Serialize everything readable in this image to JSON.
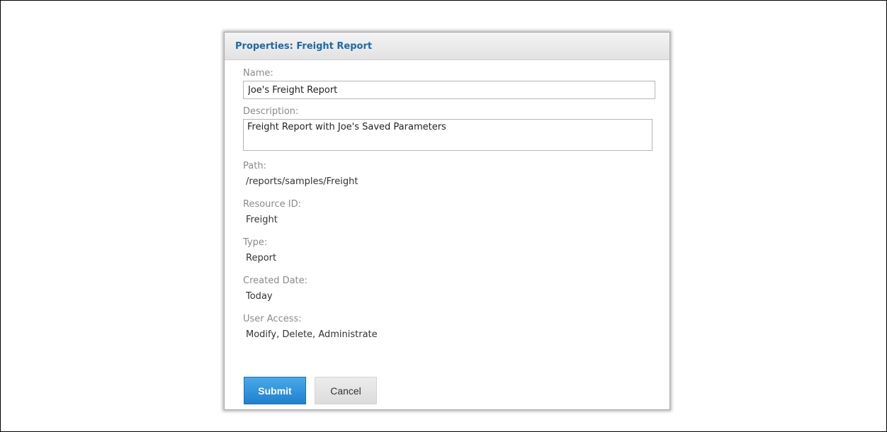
{
  "dialog": {
    "title": "Properties: Freight Report"
  },
  "fields": {
    "name": {
      "label": "Name:",
      "value": "Joe's Freight Report"
    },
    "description": {
      "label": "Description:",
      "value": "Freight Report with Joe's Saved Parameters"
    },
    "path": {
      "label": "Path:",
      "value": "/reports/samples/Freight"
    },
    "resource_id": {
      "label": "Resource ID:",
      "value": "Freight"
    },
    "type": {
      "label": "Type:",
      "value": "Report"
    },
    "created_date": {
      "label": "Created Date:",
      "value": "Today"
    },
    "user_access": {
      "label": "User Access:",
      "value": "Modify, Delete, Administrate"
    }
  },
  "buttons": {
    "submit_label": "Submit",
    "cancel_label": "Cancel"
  },
  "colors": {
    "title": "#1b6aa5",
    "label": "#8a8a8a",
    "submit_bg": "#2a8bd8"
  }
}
